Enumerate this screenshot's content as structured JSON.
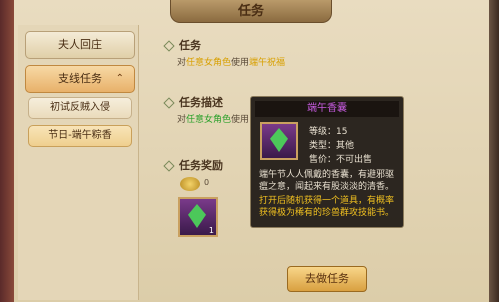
{
  "window": {
    "title": "任务"
  },
  "sidebar": {
    "main_quest": "夫人回庄",
    "branch_quest": "支线任务",
    "branch_chevron": "⌃",
    "sub_items": [
      "初试反贼入侵",
      "节日-端午粽香"
    ]
  },
  "quest": {
    "task_label": "任务",
    "task_text": {
      "prefix": "对",
      "target": "任意女角色",
      "mid": "使用",
      "item": "端午祝福"
    },
    "desc_label": "任务描述",
    "desc_text": {
      "prefix": "对",
      "target": "任意女角色",
      "mid": "使用"
    },
    "reward_label": "任务奖励",
    "reward_coin": "0",
    "reward_count": "1"
  },
  "tooltip": {
    "name": "端午香囊",
    "level": "等级：15",
    "type": "类型：其他",
    "price": "售价：不可出售",
    "desc1": "端午节人人佩戴的香囊，有避邪驱瘟之意，闻起来有股淡淡的清香。",
    "desc2": "打开后随机获得一个道具，有概率获得极为稀有的珍兽群攻技能书。"
  },
  "actions": {
    "go": "去做任务"
  },
  "colors": {
    "accent": "#e8b16a",
    "item_purple": "#c75be0",
    "highlight": "#f0c020"
  }
}
